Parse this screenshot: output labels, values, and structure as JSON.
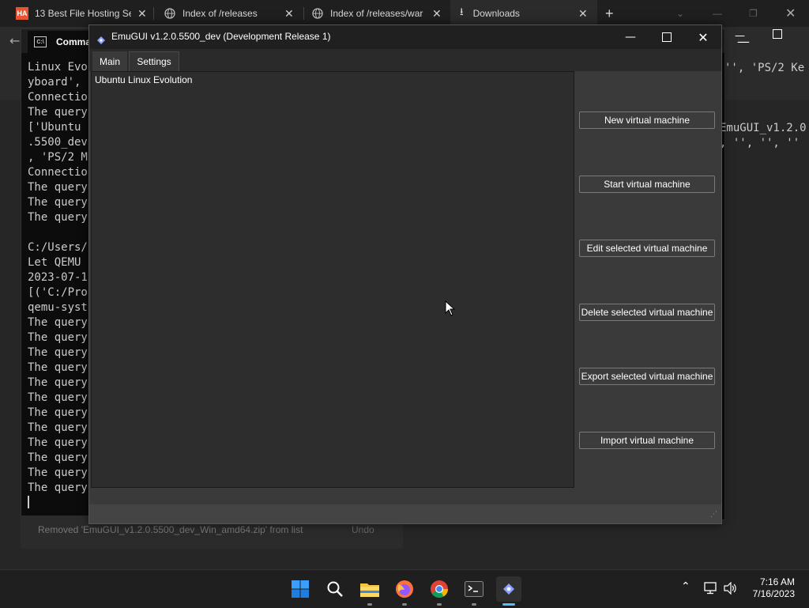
{
  "browser": {
    "tabs": [
      {
        "label": "13 Best File Hosting Se",
        "icon": "ha-logo-icon"
      },
      {
        "label": "Index of /releases",
        "icon": "globe-icon"
      },
      {
        "label": "Index of /releases/war",
        "icon": "globe-icon"
      },
      {
        "label": "Downloads",
        "icon": "download-icon"
      }
    ],
    "new_tab": "+"
  },
  "terminal": {
    "tab_label": "Comma",
    "lines": [
      "Linux Evo",
      "yboard',",
      "Connectio",
      "The query",
      "['Ubuntu",
      ".5500_dev",
      ", 'PS/2 M",
      "Connectio",
      "The query",
      "The query",
      "The query",
      "",
      "C:/Users/",
      "Let QEMU",
      "2023-07-1",
      "[('C:/Pro",
      "qemu-syst",
      "The query",
      "The query",
      "The query",
      "The query",
      "The query",
      "The query",
      "The query",
      "The query",
      "The query",
      "The query",
      "The query",
      "The query"
    ],
    "right_lines": [
      "'', 'PS/2 Ke",
      "EmuGUI_v1.2.0",
      ", '', '', ''"
    ]
  },
  "download_notice": {
    "text": "Removed 'EmuGUI_v1.2.0.5500_dev_Win_amd64.zip' from list",
    "undo": "Undo"
  },
  "emugui": {
    "title": "EmuGUI v1.2.0.5500_dev (Development Release 1)",
    "tabs": [
      "Main",
      "Settings"
    ],
    "vm_list": [
      "Ubuntu Linux Evolution"
    ],
    "buttons": [
      "New virtual machine",
      "Start virtual machine",
      "Edit selected virtual machine",
      "Delete selected virtual machine",
      "Export selected virtual machine",
      "Import virtual machine"
    ]
  },
  "taskbar": {
    "time": "7:16 AM",
    "date": "7/16/2023",
    "apps": [
      "windows-start-icon",
      "search-icon",
      "file-explorer-icon",
      "firefox-icon",
      "chrome-icon",
      "terminal-icon",
      "emugui-icon"
    ]
  },
  "colors": {
    "accent": "#0a84ff",
    "window_bg": "#3a3a3a"
  }
}
